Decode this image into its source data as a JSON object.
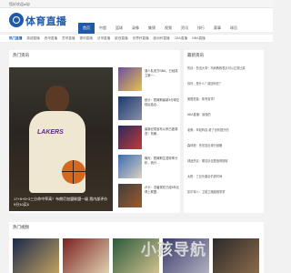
{
  "topbar": {
    "text": "您好欢迎a站!"
  },
  "header": {
    "logo_text": "体育直播"
  },
  "nav": {
    "items": [
      {
        "label": "首页",
        "active": true
      },
      {
        "label": "中超"
      },
      {
        "label": "篮球"
      },
      {
        "label": "录像"
      },
      {
        "label": "集锦"
      },
      {
        "label": "视频"
      },
      {
        "label": "资讯"
      },
      {
        "label": "排行"
      },
      {
        "label": "赛事"
      },
      {
        "label": "球员"
      }
    ]
  },
  "subnav": {
    "items": [
      {
        "label": "热门直播",
        "active": true
      },
      {
        "label": "英超直播"
      },
      {
        "label": "西甲直播"
      },
      {
        "label": "意甲直播"
      },
      {
        "label": "德甲直播"
      },
      {
        "label": "法甲直播"
      },
      {
        "label": "欧冠直播"
      },
      {
        "label": "世界杯直播"
      },
      {
        "label": "欧洲杯直播"
      },
      {
        "label": "CBA直播"
      },
      {
        "label": "NBA直播"
      }
    ]
  },
  "hot_news": {
    "title": "热门资讯",
    "feature": {
      "jersey": "LAKERS",
      "caption": "17+5+5+3三分命中率高！布朗尼加盟联盟一级 我内部评价9分10买6"
    },
    "thumbs": [
      {
        "title": "湖人队官方NBA，已经成立第一..."
      },
      {
        "title": "统计：詹姆斯最新3分球空档后结合..."
      },
      {
        "title": "最新纪录宣布以来已被调查！布朗..."
      },
      {
        "title": "曝光：詹姆斯生涯效率分析，统计..."
      },
      {
        "title": "卢卡：浓眉现在已经5年比得上联盟..."
      }
    ]
  },
  "latest_news": {
    "title": "最新资讯",
    "items": [
      "热谈：伤没大事！马刺教练表示可以正常比赛",
      "你好，是什么？原因何在？",
      "美国男篮：体育赛事？",
      "NBA直播：最强的",
      "老鹰：年轻阵容 看了也有提升的",
      "森林狼：伤愈复出得分回暖",
      "球迷热议：哪支队伍更值得期待",
      "太阳：三巨头磨合仍需时间",
      "凯尔特人：卫冕之路困难重重"
    ]
  },
  "hot_videos": {
    "title": "热门视频",
    "count": 5
  },
  "watermark": {
    "text": "小孩导航"
  },
  "colors": {
    "accent": "#1e5aa8",
    "background": "#f2f2f2"
  }
}
